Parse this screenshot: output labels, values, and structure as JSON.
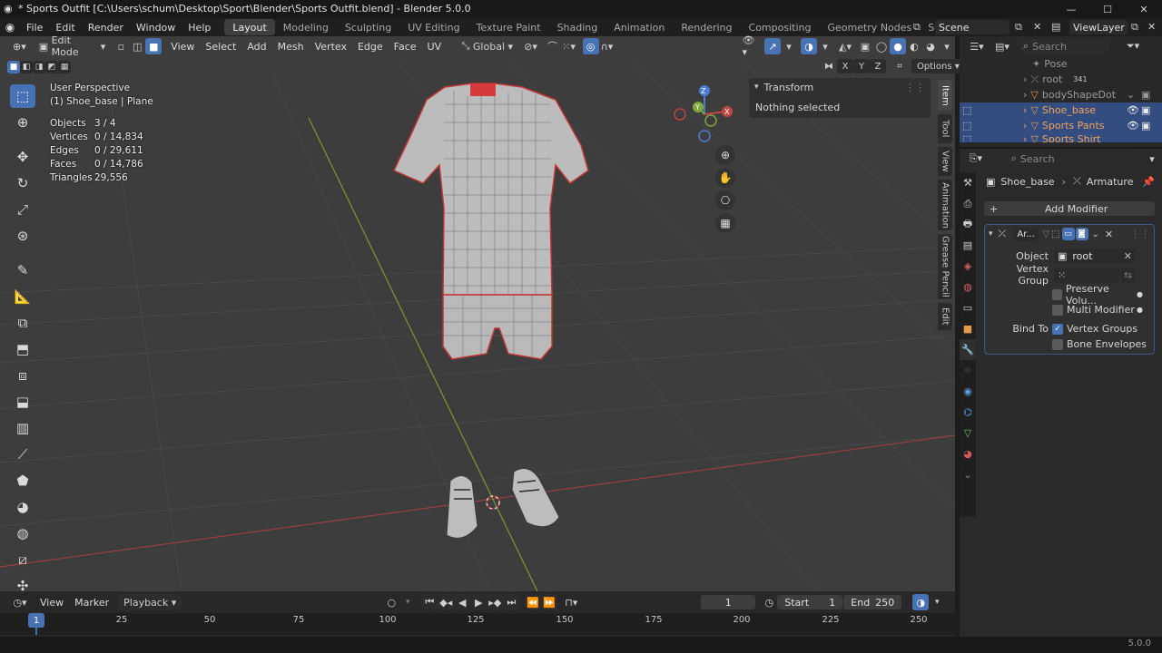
{
  "window": {
    "title": "* Sports Outfit [C:\\Users\\schum\\Desktop\\Sport\\Blender\\Sports Outfit.blend] - Blender 5.0.0",
    "controls": {
      "minimize": "—",
      "maximize": "☐",
      "close": "✕"
    }
  },
  "menubar": {
    "items": [
      "File",
      "Edit",
      "Render",
      "Window",
      "Help"
    ],
    "workspaces": [
      "Layout",
      "Modeling",
      "Sculpting",
      "UV Editing",
      "Texture Paint",
      "Shading",
      "Animation",
      "Rendering",
      "Compositing",
      "Geometry Nodes",
      "Scripting"
    ],
    "active_workspace": "Layout",
    "add_workspace": "+",
    "scene": "Scene",
    "view_layer": "ViewLayer"
  },
  "viewport_header": {
    "mode": "Edit Mode",
    "menus": [
      "View",
      "Select",
      "Add",
      "Mesh",
      "Vertex",
      "Edge",
      "Face",
      "UV"
    ],
    "orientation": "Global",
    "axes": [
      "X",
      "Y",
      "Z"
    ],
    "options": "Options"
  },
  "viewport_overlay": {
    "view_name": "User Perspective",
    "object_name": "(1) Shoe_base | Plane",
    "stats": [
      {
        "label": "Objects",
        "value": "3 / 4"
      },
      {
        "label": "Vertices",
        "value": "0 / 14,834"
      },
      {
        "label": "Edges",
        "value": "0 / 29,611"
      },
      {
        "label": "Faces",
        "value": "0 / 14,786"
      },
      {
        "label": "Triangles",
        "value": "29,556"
      }
    ],
    "gizmo": {
      "x": "X",
      "y": "Y",
      "z": "Z"
    }
  },
  "npanel": {
    "section": "Transform",
    "content": "Nothing selected",
    "tabs": [
      "Item",
      "Tool",
      "View",
      "Animation",
      "Grease Pencil",
      "Edit"
    ],
    "active_tab": "Item"
  },
  "outliner": {
    "rows": [
      {
        "name": "Pose",
        "selected": false,
        "count": ""
      },
      {
        "name": "root",
        "selected": false,
        "count": "341"
      },
      {
        "name": "bodyShapeDot",
        "selected": false,
        "count": ""
      },
      {
        "name": "Shoe_base",
        "selected": true,
        "count": ""
      },
      {
        "name": "Sports Pants",
        "selected": true,
        "count": ""
      },
      {
        "name": "Sports Shirt",
        "selected": true,
        "count": ""
      }
    ],
    "search_placeholder": "Search"
  },
  "properties": {
    "search_placeholder": "Search",
    "breadcrumb_object": "Shoe_base",
    "breadcrumb_modifier": "Armature",
    "add_modifier": "Add Modifier",
    "modifier": {
      "name": "Ar...",
      "object_label": "Object",
      "object_value": "root",
      "vertex_group_label": "Vertex Group",
      "vertex_group_value": "",
      "preserve_volume": "Preserve Volu...",
      "multi_modifier": "Multi Modifier",
      "bind_to_label": "Bind To",
      "vertex_groups": "Vertex Groups",
      "bone_envelopes": "Bone Envelopes",
      "vertex_groups_checked": true,
      "bone_envelopes_checked": false
    }
  },
  "timeline": {
    "menus": [
      "View",
      "Marker"
    ],
    "playback": "Playback",
    "current_frame": "1",
    "start_label": "Start",
    "start": "1",
    "end_label": "End",
    "end": "250",
    "ruler_ticks": [
      "25",
      "50",
      "75",
      "100",
      "125",
      "150",
      "175",
      "200",
      "225",
      "250"
    ],
    "playhead": "1"
  },
  "statusbar": {
    "version": "5.0.0"
  },
  "colors": {
    "accent": "#4772b3",
    "selection_orange": "#f2a45b",
    "viewport_bg": "#3d3d3d",
    "x_axis": "#b54a4a",
    "y_axis": "#86a83e"
  }
}
